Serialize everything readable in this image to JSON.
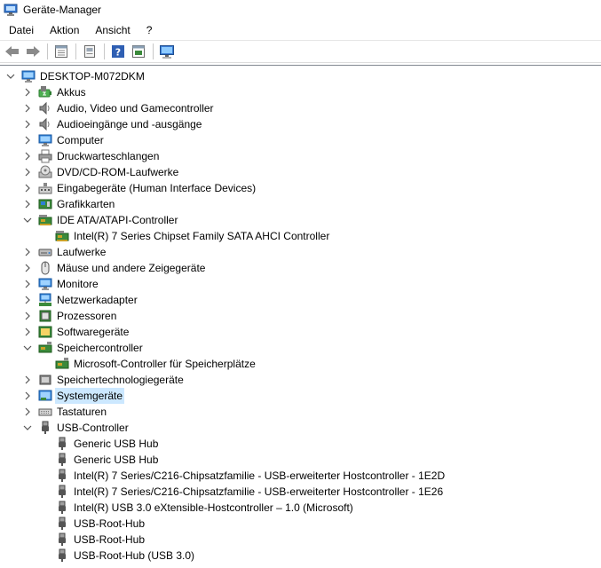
{
  "window": {
    "title": "Geräte-Manager"
  },
  "menu": [
    "Datei",
    "Aktion",
    "Ansicht",
    "?"
  ],
  "toolbar_icons": [
    "back-arrow-icon",
    "forward-arrow-icon",
    "properties-icon",
    "update-driver-icon",
    "help-icon",
    "show-hidden-icon",
    "monitor-scan-icon"
  ],
  "tree": {
    "root": {
      "label": "DESKTOP-M072DKM",
      "expanded": true
    },
    "nodes": [
      {
        "label": "Akkus",
        "icon": "battery-icon",
        "level": 1,
        "expanded": false
      },
      {
        "label": "Audio, Video und Gamecontroller",
        "icon": "speaker-icon",
        "level": 1,
        "expanded": false
      },
      {
        "label": "Audioeingänge und -ausgänge",
        "icon": "speaker-icon",
        "level": 1,
        "expanded": false
      },
      {
        "label": "Computer",
        "icon": "computer-icon",
        "level": 1,
        "expanded": false
      },
      {
        "label": "Druckwarteschlangen",
        "icon": "printer-icon",
        "level": 1,
        "expanded": false
      },
      {
        "label": "DVD/CD-ROM-Laufwerke",
        "icon": "dvd-drive-icon",
        "level": 1,
        "expanded": false
      },
      {
        "label": "Eingabegeräte (Human Interface Devices)",
        "icon": "hid-icon",
        "level": 1,
        "expanded": false
      },
      {
        "label": "Grafikkarten",
        "icon": "display-adapter-icon",
        "level": 1,
        "expanded": false
      },
      {
        "label": "IDE ATA/ATAPI-Controller",
        "icon": "controller-card-icon",
        "level": 1,
        "expanded": true
      },
      {
        "label": "Intel(R) 7 Series Chipset Family SATA AHCI Controller",
        "icon": "controller-card-icon",
        "level": 2
      },
      {
        "label": "Laufwerke",
        "icon": "disk-drive-icon",
        "level": 1,
        "expanded": false
      },
      {
        "label": "Mäuse und andere Zeigegeräte",
        "icon": "mouse-icon",
        "level": 1,
        "expanded": false
      },
      {
        "label": "Monitore",
        "icon": "monitor-icon",
        "level": 1,
        "expanded": false
      },
      {
        "label": "Netzwerkadapter",
        "icon": "network-adapter-icon",
        "level": 1,
        "expanded": false
      },
      {
        "label": "Prozessoren",
        "icon": "processor-icon",
        "level": 1,
        "expanded": false
      },
      {
        "label": "Softwaregeräte",
        "icon": "software-device-icon",
        "level": 1,
        "expanded": false
      },
      {
        "label": "Speichercontroller",
        "icon": "storage-controller-icon",
        "level": 1,
        "expanded": true
      },
      {
        "label": "Microsoft-Controller für Speicherplätze",
        "icon": "storage-controller-icon",
        "level": 2
      },
      {
        "label": "Speichertechnologiegeräte",
        "icon": "storage-tech-icon",
        "level": 1,
        "expanded": false
      },
      {
        "label": "Systemgeräte",
        "icon": "system-device-icon",
        "level": 1,
        "expanded": false,
        "selected": true
      },
      {
        "label": "Tastaturen",
        "icon": "keyboard-icon",
        "level": 1,
        "expanded": false
      },
      {
        "label": "USB-Controller",
        "icon": "usb-plug-icon",
        "level": 1,
        "expanded": true
      },
      {
        "label": "Generic USB Hub",
        "icon": "usb-plug-icon",
        "level": 2
      },
      {
        "label": "Generic USB Hub",
        "icon": "usb-plug-icon",
        "level": 2
      },
      {
        "label": "Intel(R) 7 Series/C216-Chipsatzfamilie - USB-erweiterter Hostcontroller - 1E2D",
        "icon": "usb-plug-icon",
        "level": 2
      },
      {
        "label": "Intel(R) 7 Series/C216-Chipsatzfamilie - USB-erweiterter Hostcontroller - 1E26",
        "icon": "usb-plug-icon",
        "level": 2
      },
      {
        "label": "Intel(R) USB 3.0 eXtensible-Hostcontroller – 1.0 (Microsoft)",
        "icon": "usb-plug-icon",
        "level": 2
      },
      {
        "label": "USB-Root-Hub",
        "icon": "usb-plug-icon",
        "level": 2
      },
      {
        "label": "USB-Root-Hub",
        "icon": "usb-plug-icon",
        "level": 2
      },
      {
        "label": "USB-Root-Hub (USB 3.0)",
        "icon": "usb-plug-icon",
        "level": 2
      }
    ]
  }
}
